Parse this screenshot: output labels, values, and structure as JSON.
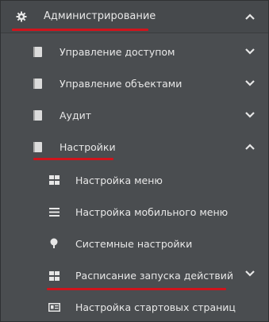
{
  "menu": {
    "top": {
      "label": "Администрирование",
      "icon": "gear-icon",
      "expanded": true
    },
    "items": [
      {
        "label": "Управление доступом",
        "icon": "book-icon",
        "expanded": false
      },
      {
        "label": "Управление объектами",
        "icon": "book-icon",
        "expanded": false
      },
      {
        "label": "Аудит",
        "icon": "book-icon",
        "expanded": false
      },
      {
        "label": "Настройки",
        "icon": "book-icon",
        "expanded": true
      }
    ],
    "subitems": [
      {
        "label": "Настройка меню",
        "icon": "grid-icon"
      },
      {
        "label": "Настройка мобильного меню",
        "icon": "list-icon"
      },
      {
        "label": "Системные настройки",
        "icon": "tree-icon"
      },
      {
        "label": "Расписание запуска действий",
        "icon": "grid-icon",
        "expanded": false
      },
      {
        "label": "Настройка стартовых страниц",
        "icon": "id-card-icon"
      }
    ]
  },
  "colors": {
    "background": "#4a4d50",
    "text": "#e8e8e8",
    "highlight_underline": "#d0141c"
  }
}
